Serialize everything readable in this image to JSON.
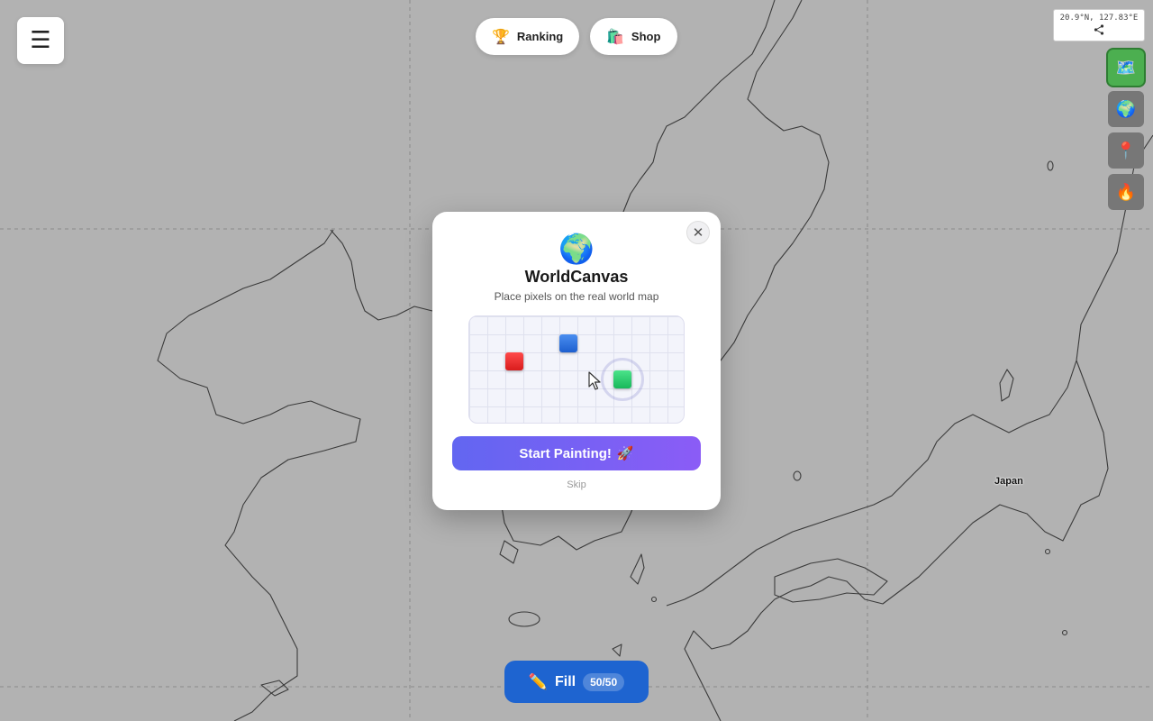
{
  "app": {
    "title": "WorldCanvas"
  },
  "header": {
    "menu_icon": "hamburger-icon",
    "menu_glyph": "☰",
    "ranking": {
      "label": "Ranking",
      "icon": "trophy-icon",
      "glyph": "🏆"
    },
    "shop": {
      "label": "Shop",
      "icon": "shopping-bags-icon",
      "glyph": "🛍️"
    }
  },
  "map": {
    "coordinates": "20.9°N, 127.83°E",
    "share_icon": "share-icon",
    "country_label": "Japan",
    "layer_buttons": [
      {
        "icon": "map-icon",
        "glyph": "🗺️",
        "active": true
      },
      {
        "icon": "globe-icon",
        "glyph": "🌍",
        "active": false
      },
      {
        "icon": "pin-icon",
        "glyph": "📍",
        "active": false
      },
      {
        "icon": "fire-icon",
        "glyph": "🔥",
        "active": false
      }
    ]
  },
  "fill": {
    "label": "Fill",
    "icon": "pencil-icon",
    "glyph": "✏️",
    "count": "50/50"
  },
  "modal": {
    "icon": "globe-icon",
    "glyph": "🌍",
    "title": "WorldCanvas",
    "subtitle": "Place pixels on the real world map",
    "close_glyph": "✕",
    "demo_pixel_colors": [
      "#e53935",
      "#2b6fd8",
      "#22c76b"
    ],
    "start_label": "Start Painting!",
    "start_icon": "rocket-icon",
    "start_glyph": "🚀",
    "skip_label": "Skip"
  },
  "colors": {
    "accent": "#6366f1",
    "fill_button": "#1e64d0",
    "active_layer": "#4caf50"
  }
}
